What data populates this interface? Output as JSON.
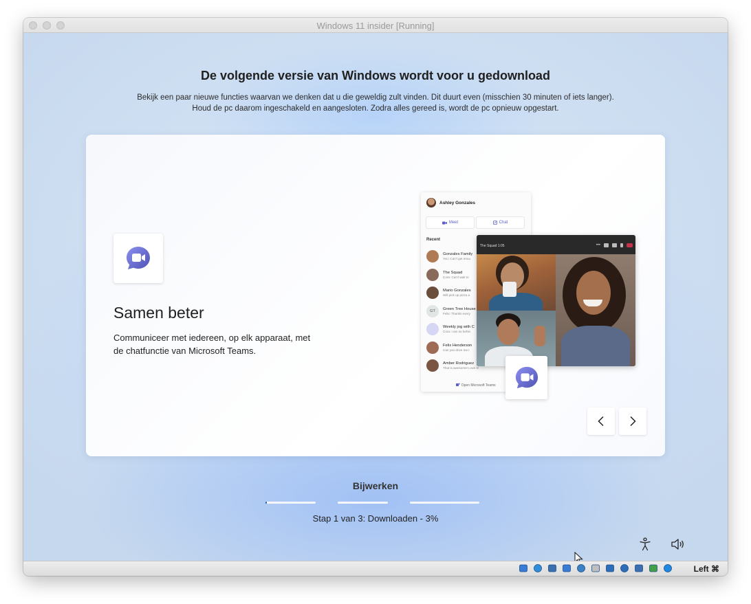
{
  "window": {
    "title": "Windows 11 insider [Running]"
  },
  "setup": {
    "heading": "De volgende versie van Windows wordt voor u gedownload",
    "subtext": "Bekijk een paar nieuwe functies waarvan we denken dat u die geweldig zult vinden. Dit duurt even (misschien 30 minuten of iets langer). Houd de pc daarom ingeschakeld en aangesloten. Zodra alles gereed is, wordt de pc opnieuw opgestart."
  },
  "feature": {
    "icon": "teams-chat-icon",
    "title": "Samen beter",
    "description": "Communiceer met iedereen, op elk apparaat, met de chatfunctie van Microsoft Teams."
  },
  "illustration": {
    "chat_panel": {
      "user_name": "Ashley Gonzales",
      "meet_label": "Meet",
      "chat_label": "Chat",
      "recent_label": "Recent",
      "contacts": [
        {
          "name": "Gonzales Family",
          "preview": "You: Can't get enou",
          "avatar_color": "#b07a55",
          "initials": ""
        },
        {
          "name": "The Squad",
          "preview": "Cora: Can't wait to",
          "avatar_color": "#8a6a5a",
          "initials": ""
        },
        {
          "name": "Mario Gonzales",
          "preview": "Will pick up pizza a",
          "avatar_color": "#6b4d3c",
          "initials": ""
        },
        {
          "name": "Green Tree House",
          "preview": "Felix: Thanks every",
          "avatar_color": "#e1e5e3",
          "initials": "GT"
        },
        {
          "name": "Weekly jog with C",
          "preview": "Cora: I am so behin",
          "avatar_color": "#d6d6f5",
          "initials": ""
        },
        {
          "name": "Felix Henderson",
          "preview": "Can you drive me t",
          "avatar_color": "#a06b55",
          "initials": ""
        },
        {
          "name": "Amber Rodriguez",
          "preview": "That is awesome! Love it!",
          "avatar_color": "#7a5544",
          "initials": ""
        }
      ],
      "open_teams_label": "Open Microsoft Teams"
    },
    "video_call": {
      "title": "The Squad 1:05"
    }
  },
  "navigation": {
    "prev_icon": "chevron-left-icon",
    "next_icon": "chevron-right-icon"
  },
  "progress": {
    "title": "Bijwerken",
    "step_text": "Stap 1 van 3: Downloaden - 3%",
    "segments": [
      0.03,
      0,
      0
    ],
    "fill_color": "#1a5fb4"
  },
  "system_icons": [
    "accessibility-icon",
    "volume-icon"
  ],
  "statusbar": {
    "icons": [
      "disk-icon",
      "optical-disk-icon",
      "audio-icon",
      "network-icon",
      "usb-icon",
      "shared-folder-icon",
      "display-icon",
      "recording-icon",
      "cpu-icon",
      "guest-additions-icon",
      "mouse-integration-icon"
    ],
    "host_key": "Left ⌘"
  }
}
